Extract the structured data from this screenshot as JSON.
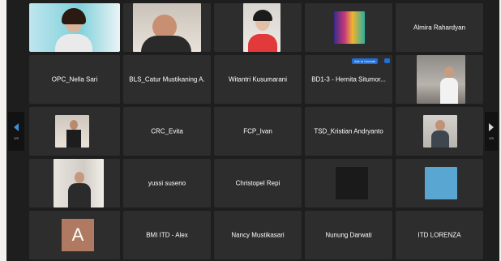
{
  "pager": {
    "left_label": "2/3",
    "right_label": "2/3"
  },
  "colors": {
    "tile_bg": "#2d2d2d",
    "stage_bg": "#1e1e1e",
    "accent": "#3b8fdd"
  },
  "tiles": {
    "r1c5": {
      "name": "Almira Rahardyan"
    },
    "r2c1": {
      "name": "OPC_Nella Sari"
    },
    "r2c2": {
      "name": "BLS_Catur Mustikaning A."
    },
    "r2c3": {
      "name": "Witantri Kusumarani"
    },
    "r2c4": {
      "name": "BD1-3 - Hernita Situmor...",
      "badge": "Ask to Unmute"
    },
    "r3c2": {
      "name": "CRC_Evita"
    },
    "r3c3": {
      "name": "FCP_Ivan"
    },
    "r3c4": {
      "name": "TSD_Kristian Andryanto"
    },
    "r4c2": {
      "name": "yussi suseno"
    },
    "r4c3": {
      "name": "Christopel Repi"
    },
    "r5c1": {
      "avatar_letter": "A"
    },
    "r5c2": {
      "name": "BMI ITD - Alex"
    },
    "r5c3": {
      "name": "Nancy Mustikasari"
    },
    "r5c4": {
      "name": "Nunung Darwati"
    },
    "r5c5": {
      "name": "ITD LORENZA"
    }
  }
}
